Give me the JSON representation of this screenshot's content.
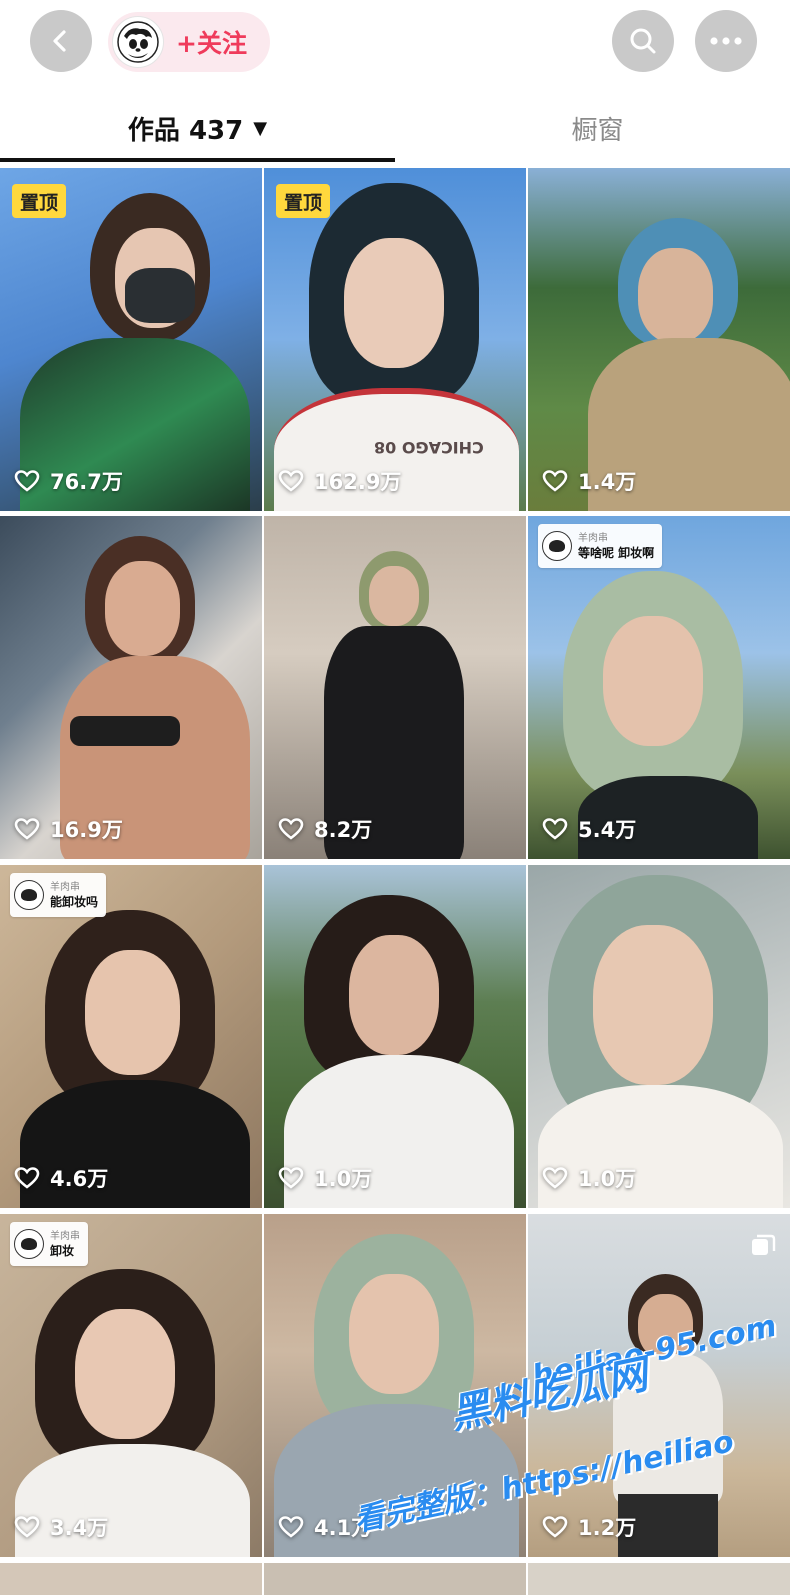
{
  "header": {
    "follow_label": "+关注",
    "icons": [
      "chevron-left-icon",
      "avatar",
      "search-icon",
      "more-icon"
    ]
  },
  "tabs": {
    "works_label": "作品 437",
    "works_caret": "▼",
    "shop_label": "橱窗"
  },
  "grid": {
    "items": [
      {
        "likes": "76.7万",
        "pinned": "置顶"
      },
      {
        "likes": "162.9万",
        "pinned": "置顶",
        "shirt_text": "CHICAGO 08"
      },
      {
        "likes": "1.4万"
      },
      {
        "likes": "16.9万"
      },
      {
        "likes": "8.2万"
      },
      {
        "likes": "5.4万",
        "caption_author": "羊肉串",
        "caption_text": "等啥呢 卸妆啊"
      },
      {
        "likes": "4.6万",
        "caption_author": "羊肉串",
        "caption_text": "能卸妆吗"
      },
      {
        "likes": "1.0万"
      },
      {
        "likes": "1.0万"
      },
      {
        "likes": "3.4万",
        "caption_author": "羊肉串",
        "caption_text": "卸妆"
      },
      {
        "likes": "4.1万"
      },
      {
        "likes": "1.2万",
        "multi_image": true
      }
    ]
  },
  "watermark": {
    "brand": "黑料吃瓜网",
    "url": "heiliao-95.com",
    "line": "看完整版：https://heiliao"
  },
  "colors": {
    "accent": "#ef3b5b",
    "pin_badge": "#ffd83d",
    "watermark": "#2a8cf0"
  }
}
